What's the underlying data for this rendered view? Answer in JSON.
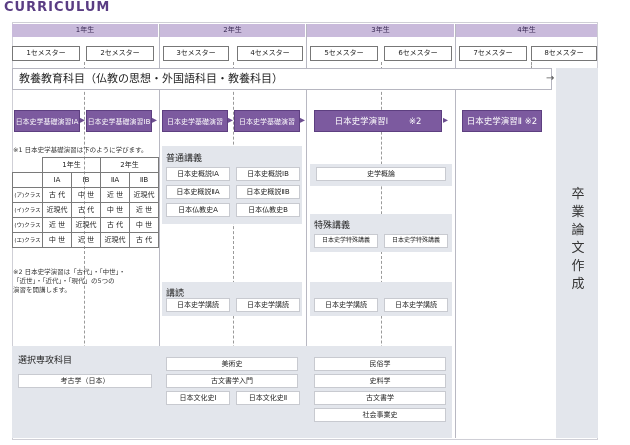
{
  "title": "CURRICULUM",
  "years": [
    "1年生",
    "2年生",
    "3年生",
    "4年生"
  ],
  "semesters": [
    "1セメスター",
    "2セメスター",
    "3セメスター",
    "4セメスター",
    "5セメスター",
    "6セメスター",
    "7セメスター",
    "8セメスター"
  ],
  "general_ed": "教養教育科目（仏教の思想・外国語科目・教養科目）",
  "graduation": [
    "卒",
    "業",
    "論",
    "文",
    "作",
    "成"
  ],
  "purple_courses": {
    "basic_1a": "日本史学基礎演習ⅠA ※1",
    "basic_1b": "日本史学基礎演習ⅠB ※1",
    "basic_2a": "日本史学基礎演習ⅡA ※1",
    "basic_2b": "日本史学基礎演習ⅡB ※1",
    "seminar_1": "日本史学演習Ⅰ",
    "seminar_1_note": "※2",
    "seminar_2": "日本史学演習Ⅱ ※2"
  },
  "note1": "※1 日本史学基礎演習は下のように学びます。",
  "class_table": {
    "year_headers": [
      "1年生",
      "2年生"
    ],
    "col_headers": [
      "ⅠA",
      "ⅠB",
      "ⅡA",
      "ⅡB"
    ],
    "rows": [
      {
        "label": "(ア)クラス",
        "cells": [
          "古 代",
          "中 世",
          "近 世",
          "近現代"
        ]
      },
      {
        "label": "(イ)クラス",
        "cells": [
          "近現代",
          "古 代",
          "中 世",
          "近 世"
        ]
      },
      {
        "label": "(ウ)クラス",
        "cells": [
          "近 世",
          "近現代",
          "古 代",
          "中 世"
        ]
      },
      {
        "label": "(エ)クラス",
        "cells": [
          "中 世",
          "近 世",
          "近現代",
          "古 代"
        ]
      }
    ]
  },
  "note2": [
    "※2 日本史学演習は「古代」・「中世」・",
    "「近世」・「近代」・「現代」の5つの",
    "演習を開講します。"
  ],
  "general_lecture": {
    "heading": "普通講義",
    "items": [
      "日本史概説ⅠA",
      "日本史概説ⅠB",
      "日本史概説ⅡA",
      "日本史概説ⅡB",
      "日本仏教史A",
      "日本仏教史B"
    ]
  },
  "survey": "史学概論",
  "special_lecture": {
    "heading": "特殊講義",
    "items": [
      "日本史学特殊講義",
      "日本史学特殊講義"
    ]
  },
  "reading": {
    "heading": "講読",
    "items": [
      "日本史学講読",
      "日本史学講読",
      "日本史学講読",
      "日本史学講読"
    ]
  },
  "elective": {
    "heading": "選択専攻科目",
    "y1": [
      "考古学（日本）"
    ],
    "y2": [
      "美術史",
      "古文書学入門",
      "日本文化史Ⅰ",
      "日本文化史Ⅱ"
    ],
    "y3": [
      "民俗学",
      "史料学",
      "古文書学",
      "社会事業史"
    ]
  }
}
